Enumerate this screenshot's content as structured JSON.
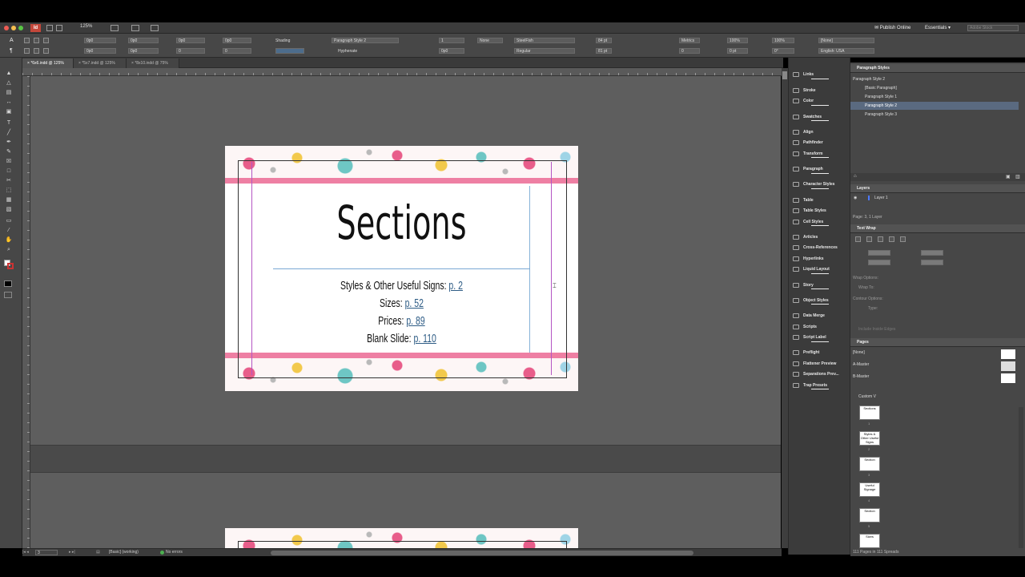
{
  "menu": {
    "zoom": "125%"
  },
  "header": {
    "publish_online": "Publish Online",
    "workspace": "Essentials",
    "search_placeholder": "Adobe Stock"
  },
  "control": {
    "x": "0p0",
    "y": "0p0",
    "w": "0p0",
    "h": "0p0",
    "angle": "0",
    "shading": "Shading",
    "paragraph_style": "Paragraph Style 2",
    "none": "None",
    "hyphenate": "Hyphenate",
    "font": "SteelFish",
    "font_size": "84 pt",
    "leading": "81 pt",
    "font_style": "Regular",
    "kerning": "Metrics",
    "tracking": "0",
    "scale_h": "100%",
    "scale_v": "100%",
    "baseline": "0 pt",
    "skew": "0°",
    "char_style": "[None]",
    "language": "English: USA",
    "num_field": "1"
  },
  "tabs": [
    "*6x6.indd @ 125%",
    "*5x7.indd @ 125%",
    "*8x10.indd @ 75%"
  ],
  "document": {
    "title": "Sections",
    "entries": [
      {
        "label": "Styles & Other Useful Signs: ",
        "link": "p. 2"
      },
      {
        "label": "Sizes: ",
        "link": "p. 52"
      },
      {
        "label": "Prices: ",
        "link": "p. 89"
      },
      {
        "label": "Blank Slide: ",
        "link": "p. 110"
      }
    ]
  },
  "panels": [
    {
      "label": "Links",
      "icon": "links-icon"
    },
    {
      "label": "Stroke",
      "icon": "stroke-icon"
    },
    {
      "label": "Color",
      "icon": "color-icon"
    },
    {
      "label": "Swatches",
      "icon": "swatches-icon"
    },
    {
      "label": "Align",
      "icon": "align-icon"
    },
    {
      "label": "Pathfinder",
      "icon": "pathfinder-icon"
    },
    {
      "label": "Transform",
      "icon": "transform-icon"
    },
    {
      "label": "Paragraph",
      "icon": "paragraph-icon"
    },
    {
      "label": "Character Styles",
      "icon": "character-styles-icon"
    },
    {
      "label": "Table",
      "icon": "table-icon"
    },
    {
      "label": "Table Styles",
      "icon": "table-styles-icon"
    },
    {
      "label": "Cell Styles",
      "icon": "cell-styles-icon"
    },
    {
      "label": "Articles",
      "icon": "articles-icon"
    },
    {
      "label": "Cross-References",
      "icon": "cross-references-icon"
    },
    {
      "label": "Hyperlinks",
      "icon": "hyperlinks-icon"
    },
    {
      "label": "Liquid Layout",
      "icon": "liquid-layout-icon"
    },
    {
      "label": "Story",
      "icon": "story-icon"
    },
    {
      "label": "Object Styles",
      "icon": "object-styles-icon"
    },
    {
      "label": "Data Merge",
      "icon": "data-merge-icon"
    },
    {
      "label": "Scripts",
      "icon": "scripts-icon"
    },
    {
      "label": "Script Label",
      "icon": "script-label-icon"
    },
    {
      "label": "Preflight",
      "icon": "preflight-icon"
    },
    {
      "label": "Flattener Preview",
      "icon": "flattener-preview-icon"
    },
    {
      "label": "Separations Prev...",
      "icon": "separations-preview-icon"
    },
    {
      "label": "Trap Presets",
      "icon": "trap-presets-icon"
    }
  ],
  "paragraph_styles": {
    "title": "Paragraph Styles",
    "current": "Paragraph Style 2",
    "items": [
      "[Basic Paragraph]",
      "Paragraph Style 1",
      "Paragraph Style 2",
      "Paragraph Style 3"
    ]
  },
  "layers": {
    "title": "Layers",
    "layer": "Layer 1",
    "summary": "Page: 3, 1 Layer"
  },
  "text_wrap": {
    "title": "Text Wrap",
    "wrap_options": "Wrap Options:",
    "wrap_to": "Wrap To:",
    "contour_options": "Contour Options:",
    "type": "Type:",
    "include_inside": "Include Inside Edges"
  },
  "pages": {
    "title": "Pages",
    "none": "[None]",
    "a_master": "A-Master",
    "b_master": "B-Master",
    "custom": "Custom V",
    "thumbs": [
      "Sections",
      "Styles & Other Useful Signs",
      "Section",
      "Useful Signage",
      "Section",
      "Sizes"
    ],
    "page_numbers": [
      "1",
      "2",
      "3",
      "4",
      "5"
    ],
    "summary": "111 Pages in 111 Spreads"
  },
  "status": {
    "page": "3",
    "style": "[Basic] (working)",
    "errors": "No errors"
  }
}
